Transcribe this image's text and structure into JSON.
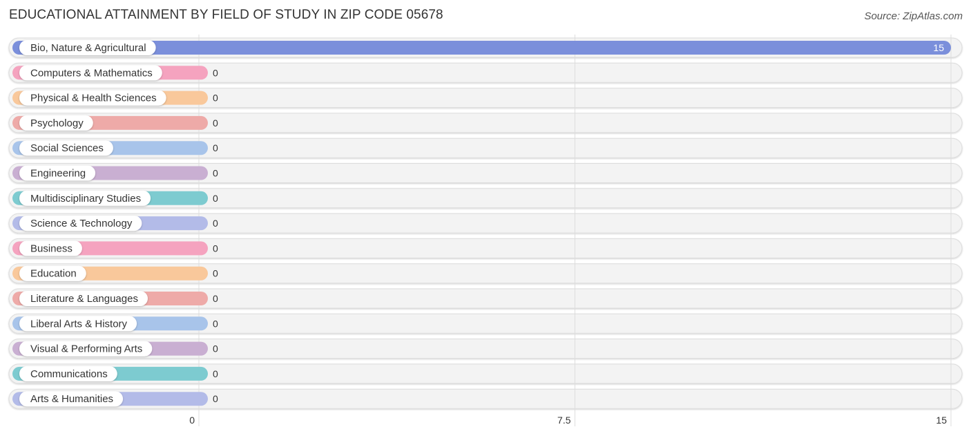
{
  "header": {
    "title": "EDUCATIONAL ATTAINMENT BY FIELD OF STUDY IN ZIP CODE 05678",
    "source": "Source: ZipAtlas.com"
  },
  "chart_data": {
    "type": "bar",
    "orientation": "horizontal",
    "title": "EDUCATIONAL ATTAINMENT BY FIELD OF STUDY IN ZIP CODE 05678",
    "xlabel": "",
    "ylabel": "",
    "xlim": [
      0,
      15
    ],
    "grid": true,
    "x_ticks": [
      "0",
      "7.5",
      "15"
    ],
    "x_tick_values": [
      0,
      7.5,
      15
    ],
    "categories": [
      "Bio, Nature & Agricultural",
      "Computers & Mathematics",
      "Physical & Health Sciences",
      "Psychology",
      "Social Sciences",
      "Engineering",
      "Multidisciplinary Studies",
      "Science & Technology",
      "Business",
      "Education",
      "Literature & Languages",
      "Liberal Arts & History",
      "Visual & Performing Arts",
      "Communications",
      "Arts & Humanities"
    ],
    "values": [
      15,
      0,
      0,
      0,
      0,
      0,
      0,
      0,
      0,
      0,
      0,
      0,
      0,
      0,
      0
    ],
    "value_labels": [
      "15",
      "0",
      "0",
      "0",
      "0",
      "0",
      "0",
      "0",
      "0",
      "0",
      "0",
      "0",
      "0",
      "0",
      "0"
    ],
    "colors": [
      "#7b8fdb",
      "#f5a3bf",
      "#f9c89b",
      "#eeaaa8",
      "#a8c4ea",
      "#c9afd2",
      "#7dcbd0",
      "#b3bbe8",
      "#f5a3bf",
      "#f9c89b",
      "#eeaaa8",
      "#a8c4ea",
      "#c9afd2",
      "#7dcbd0",
      "#b3bbe8"
    ]
  }
}
